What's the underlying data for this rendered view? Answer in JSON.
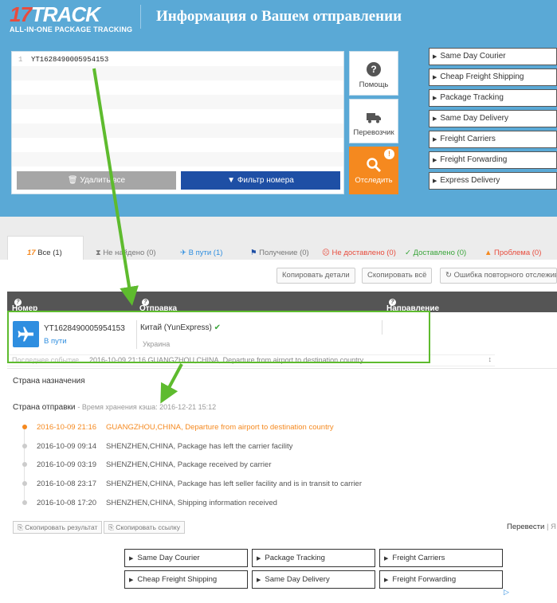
{
  "header": {
    "logo_number": "17",
    "logo_word": "TRACK",
    "logo_tagline": "ALL-IN-ONE PACKAGE TRACKING",
    "title": "Информация о Вашем отправлении"
  },
  "input": {
    "lines": [
      {
        "num": "1",
        "text": "YT1628490005954153"
      }
    ],
    "delete_label": "Удалить все",
    "filter_label": "Фильтр номера"
  },
  "side_buttons": {
    "help": "Помощь",
    "carrier": "Перевозчик",
    "track": "Отследить",
    "track_badge": "!"
  },
  "right_links": [
    "Same Day Courier",
    "Cheap Freight Shipping",
    "Package Tracking",
    "Same Day Delivery",
    "Freight Carriers",
    "Freight Forwarding",
    "Express Delivery"
  ],
  "tabs": [
    {
      "label": "Все",
      "count": "(1)"
    },
    {
      "label": "Не найдено",
      "count": "(0)"
    },
    {
      "label": "В пути",
      "count": "(1)"
    },
    {
      "label": "Получение",
      "count": "(0)"
    },
    {
      "label": "Не доставлено",
      "count": "(0)"
    },
    {
      "label": "Доставлено",
      "count": "(0)"
    },
    {
      "label": "Проблема",
      "count": "(0)"
    }
  ],
  "toolbar": {
    "copy_details": "Копировать детали",
    "copy_all": "Скопировать всё",
    "retry_error": "Ошибка повторного отслежива"
  },
  "table": {
    "col_number": "Номер (статус)",
    "col_origin": "Отправка (перевозчик)",
    "col_dest": "Направление (перевозчик)"
  },
  "shipment": {
    "number": "YT1628490005954153",
    "status": "В пути",
    "origin": "Китай (YunExpress)",
    "destination": "Украина",
    "last_event_label": "Последнее событие",
    "last_event": "2016-10-09 21:16 GUANGZHOU,CHINA, Departure from airport to destination country"
  },
  "details": {
    "dest_country_label": "Страна назначения",
    "origin_country_label": "Страна отправки",
    "cache_label": "Время хранения кэша:",
    "cache_time": "2016-12-21 15:12",
    "events": [
      {
        "date": "2016-10-09 21:16",
        "text": "GUANGZHOU,CHINA, Departure from airport to destination country"
      },
      {
        "date": "2016-10-09 09:14",
        "text": "SHENZHEN,CHINA, Package has left the carrier facility"
      },
      {
        "date": "2016-10-09 03:19",
        "text": "SHENZHEN,CHINA, Package received by carrier"
      },
      {
        "date": "2016-10-08 23:17",
        "text": "SHENZHEN,CHINA, Package has left seller facility and is in transit to carrier"
      },
      {
        "date": "2016-10-08 17:20",
        "text": "SHENZHEN,CHINA, Shipping information received"
      }
    ],
    "copy_result": "Скопировать результат",
    "copy_link": "Скопировать ссылку",
    "translate": "Перевести"
  },
  "bottom_links": [
    "Same Day Courier",
    "Package Tracking",
    "Freight Carriers",
    "Cheap Freight Shipping",
    "Same Day Delivery",
    "Freight Forwarding"
  ],
  "colors": {
    "accent_blue": "#1e4fa5",
    "orange": "#f5891f",
    "annotation_green": "#5ebb2e",
    "header_bg": "#5aa9d6"
  }
}
